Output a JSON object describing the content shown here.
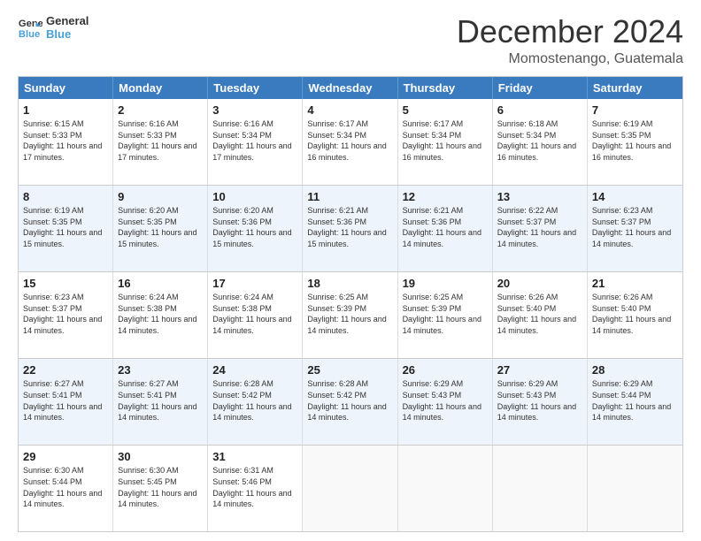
{
  "logo": {
    "line1": "General",
    "line2": "Blue"
  },
  "title": "December 2024",
  "subtitle": "Momostenango, Guatemala",
  "days_of_week": [
    "Sunday",
    "Monday",
    "Tuesday",
    "Wednesday",
    "Thursday",
    "Friday",
    "Saturday"
  ],
  "weeks": [
    [
      {
        "day": "1",
        "sunrise": "6:15 AM",
        "sunset": "5:33 PM",
        "daylight": "11 hours and 17 minutes."
      },
      {
        "day": "2",
        "sunrise": "6:16 AM",
        "sunset": "5:33 PM",
        "daylight": "11 hours and 17 minutes."
      },
      {
        "day": "3",
        "sunrise": "6:16 AM",
        "sunset": "5:34 PM",
        "daylight": "11 hours and 17 minutes."
      },
      {
        "day": "4",
        "sunrise": "6:17 AM",
        "sunset": "5:34 PM",
        "daylight": "11 hours and 16 minutes."
      },
      {
        "day": "5",
        "sunrise": "6:17 AM",
        "sunset": "5:34 PM",
        "daylight": "11 hours and 16 minutes."
      },
      {
        "day": "6",
        "sunrise": "6:18 AM",
        "sunset": "5:34 PM",
        "daylight": "11 hours and 16 minutes."
      },
      {
        "day": "7",
        "sunrise": "6:19 AM",
        "sunset": "5:35 PM",
        "daylight": "11 hours and 16 minutes."
      }
    ],
    [
      {
        "day": "8",
        "sunrise": "6:19 AM",
        "sunset": "5:35 PM",
        "daylight": "11 hours and 15 minutes."
      },
      {
        "day": "9",
        "sunrise": "6:20 AM",
        "sunset": "5:35 PM",
        "daylight": "11 hours and 15 minutes."
      },
      {
        "day": "10",
        "sunrise": "6:20 AM",
        "sunset": "5:36 PM",
        "daylight": "11 hours and 15 minutes."
      },
      {
        "day": "11",
        "sunrise": "6:21 AM",
        "sunset": "5:36 PM",
        "daylight": "11 hours and 15 minutes."
      },
      {
        "day": "12",
        "sunrise": "6:21 AM",
        "sunset": "5:36 PM",
        "daylight": "11 hours and 14 minutes."
      },
      {
        "day": "13",
        "sunrise": "6:22 AM",
        "sunset": "5:37 PM",
        "daylight": "11 hours and 14 minutes."
      },
      {
        "day": "14",
        "sunrise": "6:23 AM",
        "sunset": "5:37 PM",
        "daylight": "11 hours and 14 minutes."
      }
    ],
    [
      {
        "day": "15",
        "sunrise": "6:23 AM",
        "sunset": "5:37 PM",
        "daylight": "11 hours and 14 minutes."
      },
      {
        "day": "16",
        "sunrise": "6:24 AM",
        "sunset": "5:38 PM",
        "daylight": "11 hours and 14 minutes."
      },
      {
        "day": "17",
        "sunrise": "6:24 AM",
        "sunset": "5:38 PM",
        "daylight": "11 hours and 14 minutes."
      },
      {
        "day": "18",
        "sunrise": "6:25 AM",
        "sunset": "5:39 PM",
        "daylight": "11 hours and 14 minutes."
      },
      {
        "day": "19",
        "sunrise": "6:25 AM",
        "sunset": "5:39 PM",
        "daylight": "11 hours and 14 minutes."
      },
      {
        "day": "20",
        "sunrise": "6:26 AM",
        "sunset": "5:40 PM",
        "daylight": "11 hours and 14 minutes."
      },
      {
        "day": "21",
        "sunrise": "6:26 AM",
        "sunset": "5:40 PM",
        "daylight": "11 hours and 14 minutes."
      }
    ],
    [
      {
        "day": "22",
        "sunrise": "6:27 AM",
        "sunset": "5:41 PM",
        "daylight": "11 hours and 14 minutes."
      },
      {
        "day": "23",
        "sunrise": "6:27 AM",
        "sunset": "5:41 PM",
        "daylight": "11 hours and 14 minutes."
      },
      {
        "day": "24",
        "sunrise": "6:28 AM",
        "sunset": "5:42 PM",
        "daylight": "11 hours and 14 minutes."
      },
      {
        "day": "25",
        "sunrise": "6:28 AM",
        "sunset": "5:42 PM",
        "daylight": "11 hours and 14 minutes."
      },
      {
        "day": "26",
        "sunrise": "6:29 AM",
        "sunset": "5:43 PM",
        "daylight": "11 hours and 14 minutes."
      },
      {
        "day": "27",
        "sunrise": "6:29 AM",
        "sunset": "5:43 PM",
        "daylight": "11 hours and 14 minutes."
      },
      {
        "day": "28",
        "sunrise": "6:29 AM",
        "sunset": "5:44 PM",
        "daylight": "11 hours and 14 minutes."
      }
    ],
    [
      {
        "day": "29",
        "sunrise": "6:30 AM",
        "sunset": "5:44 PM",
        "daylight": "11 hours and 14 minutes."
      },
      {
        "day": "30",
        "sunrise": "6:30 AM",
        "sunset": "5:45 PM",
        "daylight": "11 hours and 14 minutes."
      },
      {
        "day": "31",
        "sunrise": "6:31 AM",
        "sunset": "5:46 PM",
        "daylight": "11 hours and 14 minutes."
      },
      null,
      null,
      null,
      null
    ]
  ]
}
